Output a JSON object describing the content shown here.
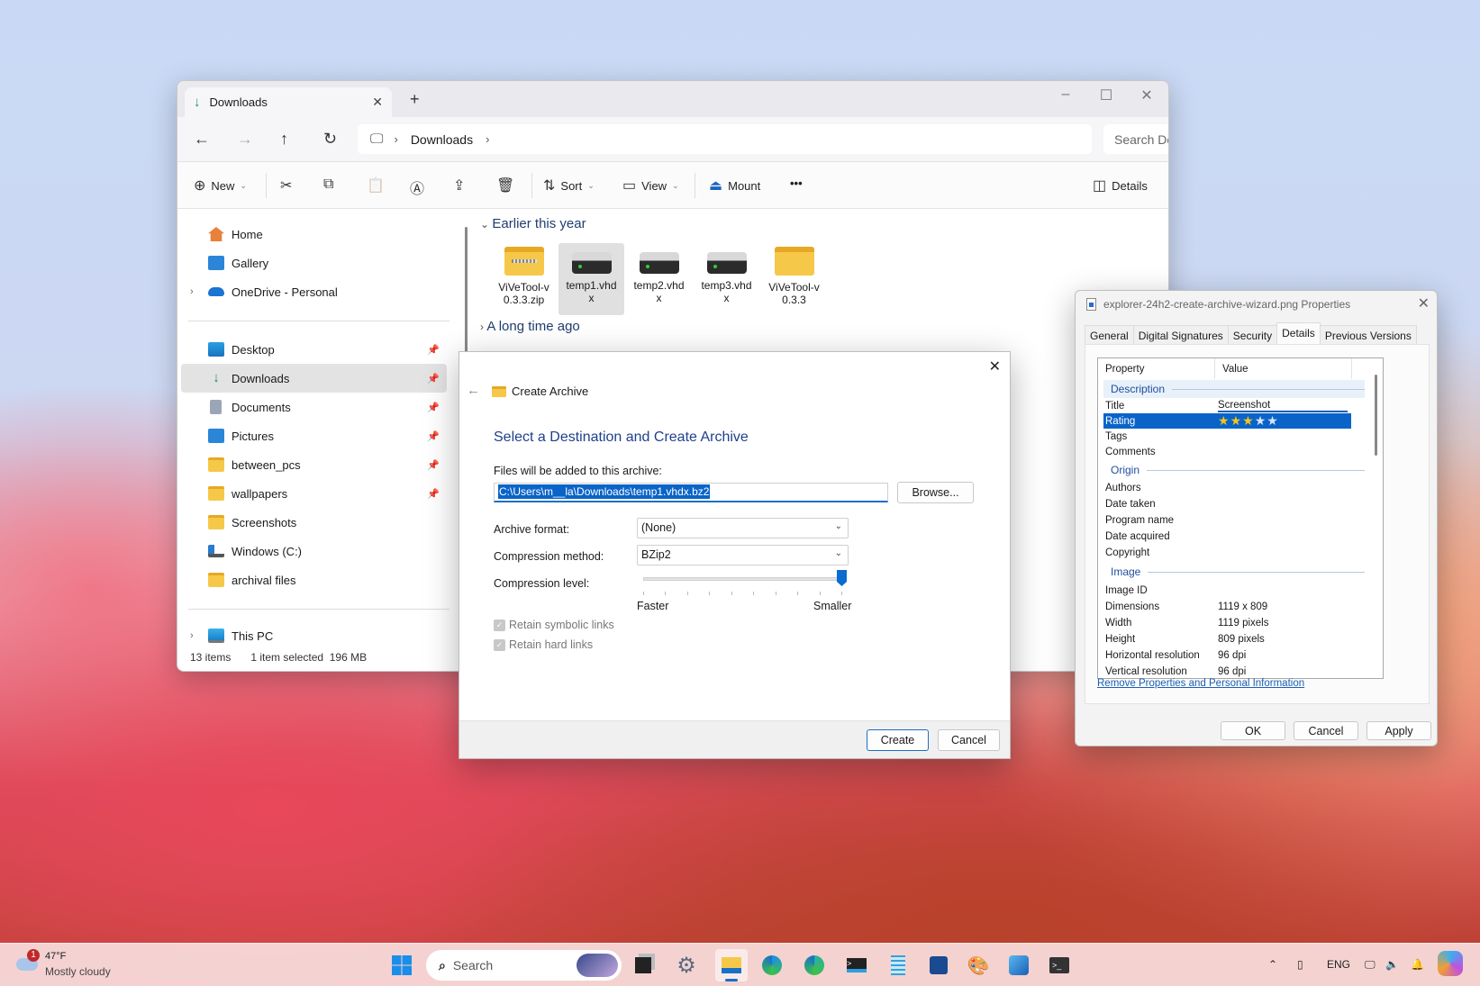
{
  "explorer": {
    "tab_title": "Downloads",
    "window_controls": {
      "minimize": "–",
      "maximize": "☐",
      "close": "✕"
    },
    "breadcrumb": [
      "Downloads"
    ],
    "search_placeholder": "Search Downloads",
    "toolbar": {
      "new": "New",
      "sort": "Sort",
      "view": "View",
      "mount": "Mount",
      "more": "•••",
      "details": "Details"
    },
    "sidebar": {
      "quick": [
        {
          "label": "Home"
        },
        {
          "label": "Gallery"
        },
        {
          "label": "OneDrive - Personal"
        }
      ],
      "pinned": [
        {
          "label": "Desktop"
        },
        {
          "label": "Downloads"
        },
        {
          "label": "Documents"
        },
        {
          "label": "Pictures"
        },
        {
          "label": "between_pcs"
        },
        {
          "label": "wallpapers"
        },
        {
          "label": "Screenshots"
        },
        {
          "label": "Windows (C:)"
        },
        {
          "label": "archival files"
        }
      ],
      "this_pc": "This PC"
    },
    "groups": [
      {
        "label": "Earlier this year",
        "expanded": true
      },
      {
        "label": "A long time ago",
        "expanded": false
      }
    ],
    "files": [
      {
        "name": "ViVeTool-v0.3.3.zip",
        "line1": "ViVeTool-v",
        "line2": "0.3.3.zip",
        "type": "zip"
      },
      {
        "name": "temp1.vhdx",
        "line1": "temp1.vhd",
        "line2": "x",
        "type": "vhdx",
        "selected": true
      },
      {
        "name": "temp2.vhdx",
        "line1": "temp2.vhd",
        "line2": "x",
        "type": "vhdx"
      },
      {
        "name": "temp3.vhdx",
        "line1": "temp3.vhd",
        "line2": "x",
        "type": "vhdx"
      },
      {
        "name": "ViVeTool-v0.3.3",
        "line1": "ViVeTool-v",
        "line2": "0.3.3",
        "type": "folder"
      }
    ],
    "status": {
      "count": "13 items",
      "selection": "1 item selected",
      "size": "196 MB"
    }
  },
  "archive_dialog": {
    "header": "Create Archive",
    "heading": "Select a Destination and Create Archive",
    "files_label": "Files will be added to this archive:",
    "path": "C:\\Users\\m__la\\Downloads\\temp1.vhdx.bz2",
    "browse": "Browse...",
    "format_label": "Archive format:",
    "format_value": "(None)",
    "method_label": "Compression method:",
    "method_value": "BZip2",
    "level_label": "Compression level:",
    "level_min_label": "Faster",
    "level_max_label": "Smaller",
    "level_fraction": 1.0,
    "retain_symlinks": "Retain symbolic links",
    "retain_hardlinks": "Retain hard links",
    "create": "Create",
    "cancel": "Cancel"
  },
  "properties_dialog": {
    "title": "explorer-24h2-create-archive-wizard.png Properties",
    "tabs": [
      "General",
      "Digital Signatures",
      "Security",
      "Details",
      "Previous Versions"
    ],
    "active_tab": "Details",
    "col_property": "Property",
    "col_value": "Value",
    "groups": {
      "description": "Description",
      "origin": "Origin",
      "image": "Image"
    },
    "rows": {
      "title": {
        "k": "Title",
        "v": "Screenshot"
      },
      "rating": {
        "k": "Rating",
        "stars": 3,
        "max": 5
      },
      "tags": {
        "k": "Tags",
        "v": ""
      },
      "comments": {
        "k": "Comments",
        "v": ""
      },
      "authors": {
        "k": "Authors",
        "v": ""
      },
      "date_taken": {
        "k": "Date taken",
        "v": ""
      },
      "program_name": {
        "k": "Program name",
        "v": ""
      },
      "date_acquired": {
        "k": "Date acquired",
        "v": ""
      },
      "copyright": {
        "k": "Copyright",
        "v": ""
      },
      "image_id": {
        "k": "Image ID",
        "v": ""
      },
      "dimensions": {
        "k": "Dimensions",
        "v": "1119 x 809"
      },
      "width": {
        "k": "Width",
        "v": "1119 pixels"
      },
      "height": {
        "k": "Height",
        "v": "809 pixels"
      },
      "hres": {
        "k": "Horizontal resolution",
        "v": "96 dpi"
      },
      "vres": {
        "k": "Vertical resolution",
        "v": "96 dpi"
      }
    },
    "remove_link": "Remove Properties and Personal Information",
    "ok": "OK",
    "cancel": "Cancel",
    "apply": "Apply"
  },
  "taskbar": {
    "weather": {
      "temp": "47°F",
      "desc": "Mostly cloudy",
      "badge": "1"
    },
    "search_placeholder": "Search",
    "tray": {
      "lang": "ENG"
    }
  }
}
